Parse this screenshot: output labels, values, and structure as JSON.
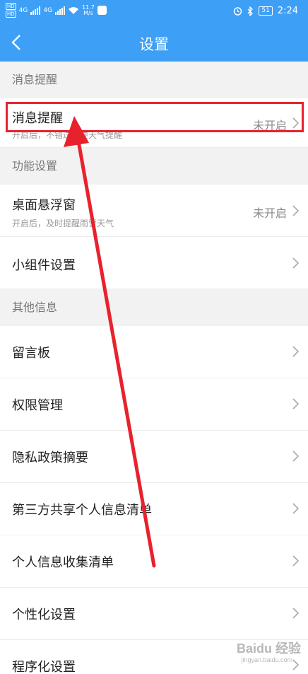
{
  "status": {
    "hd1": "HD",
    "hd2": "HD",
    "net1": "4G",
    "net2": "4G",
    "speed_value": "11.7",
    "speed_unit": "M/s",
    "battery": "51",
    "time": "2:24"
  },
  "header": {
    "title": "设置"
  },
  "sections": {
    "message": "消息提醒",
    "function": "功能设置",
    "other": "其他信息"
  },
  "rows": {
    "message_reminder": {
      "label": "消息提醒",
      "sub": "开启后，不错过重要天气提醒",
      "value": "未开启"
    },
    "floating_window": {
      "label": "桌面悬浮窗",
      "sub": "开启后，及时提醒雨雪天气",
      "value": "未开启"
    },
    "widget": {
      "label": "小组件设置"
    },
    "message_board": {
      "label": "留言板"
    },
    "permissions": {
      "label": "权限管理"
    },
    "privacy_summary": {
      "label": "隐私政策摘要"
    },
    "third_party": {
      "label": "第三方共享个人信息清单"
    },
    "personal_info": {
      "label": "个人信息收集清单"
    },
    "personalized": {
      "label": "个性化设置"
    },
    "programmatic": {
      "label": "程序化设置"
    }
  },
  "watermark": {
    "brand": "Baidu 经验",
    "url": "jingyan.baidu.com"
  },
  "colors": {
    "header_bg": "#3d9ff5",
    "annotation_red": "#e8222d"
  }
}
